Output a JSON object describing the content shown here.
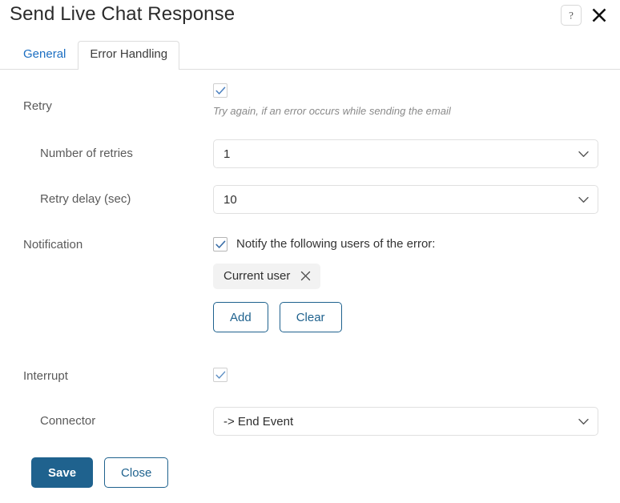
{
  "dialog": {
    "title": "Send Live Chat Response",
    "help_icon": "question-mark-icon",
    "close_icon": "close-icon"
  },
  "tabs": [
    {
      "label": "General",
      "active": false
    },
    {
      "label": "Error Handling",
      "active": true
    }
  ],
  "form": {
    "retry": {
      "label": "Retry",
      "checked": true,
      "hint": "Try again, if an error occurs while sending the email"
    },
    "number_of_retries": {
      "label": "Number of retries",
      "value": "1"
    },
    "retry_delay": {
      "label": "Retry delay (sec)",
      "value": "10"
    },
    "notification": {
      "label": "Notification",
      "checked": true,
      "caption": "Notify the following users of the error:",
      "chips": [
        {
          "label": "Current user",
          "remove_icon": "close-icon"
        }
      ],
      "add_label": "Add",
      "clear_label": "Clear"
    },
    "interrupt": {
      "label": "Interrupt",
      "checked": true
    },
    "connector": {
      "label": "Connector",
      "value": "-> End Event"
    }
  },
  "footer": {
    "save_label": "Save",
    "close_label": "Close"
  },
  "colors": {
    "accent_blue": "#1f628e",
    "link_blue": "#1b6ec2",
    "check_blue": "#4a7fbf",
    "border_gray": "#e0e0e0",
    "chip_bg": "#f2f2f2"
  }
}
